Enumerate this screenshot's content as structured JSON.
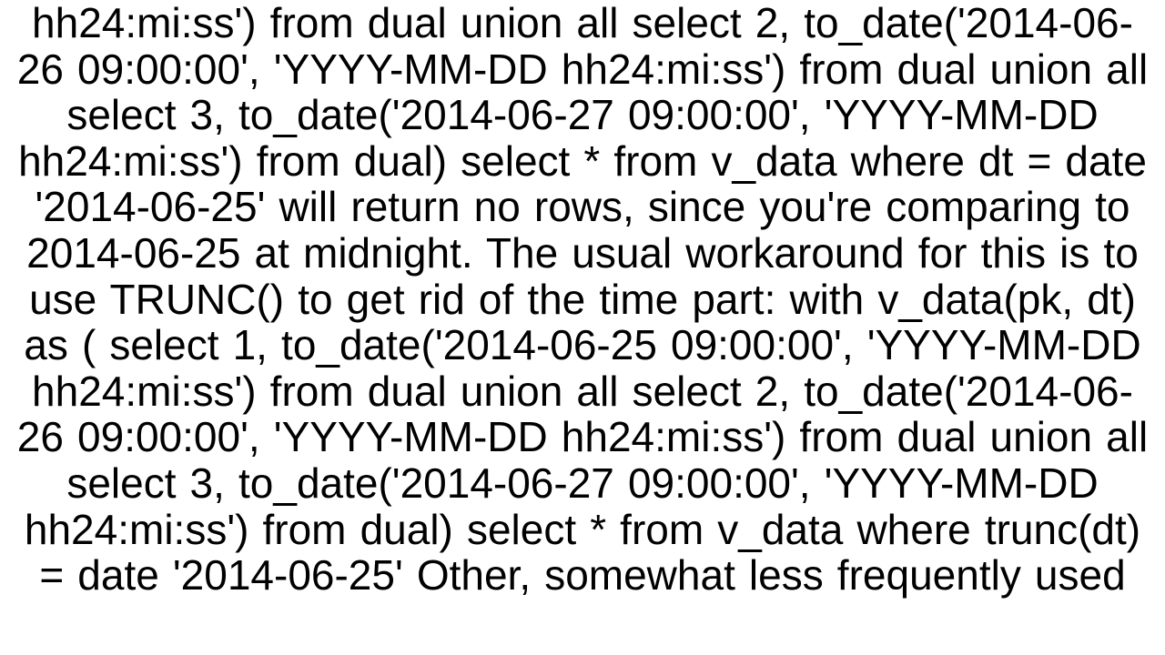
{
  "document": {
    "body_text": "hh24:mi:ss') from dual union all   select 2, to_date('2014-06-26 09:00:00', 'YYYY-MM-DD hh24:mi:ss') from dual union all    select 3, to_date('2014-06-27 09:00:00', 'YYYY-MM-DD hh24:mi:ss') from dual) select * from v_data where dt = date '2014-06-25'    will return no rows, since you're comparing to 2014-06-25 at midnight. The usual workaround for this is to use TRUNC() to get rid of the time part: with v_data(pk, dt) as (   select 1, to_date('2014-06-25 09:00:00', 'YYYY-MM-DD hh24:mi:ss') from dual union all   select 2, to_date('2014-06-26 09:00:00', 'YYYY-MM-DD hh24:mi:ss') from dual union all    select 3, to_date('2014-06-27 09:00:00', 'YYYY-MM-DD hh24:mi:ss') from dual) select * from v_data where trunc(dt) = date '2014-06-25'   Other, somewhat less frequently used"
  }
}
